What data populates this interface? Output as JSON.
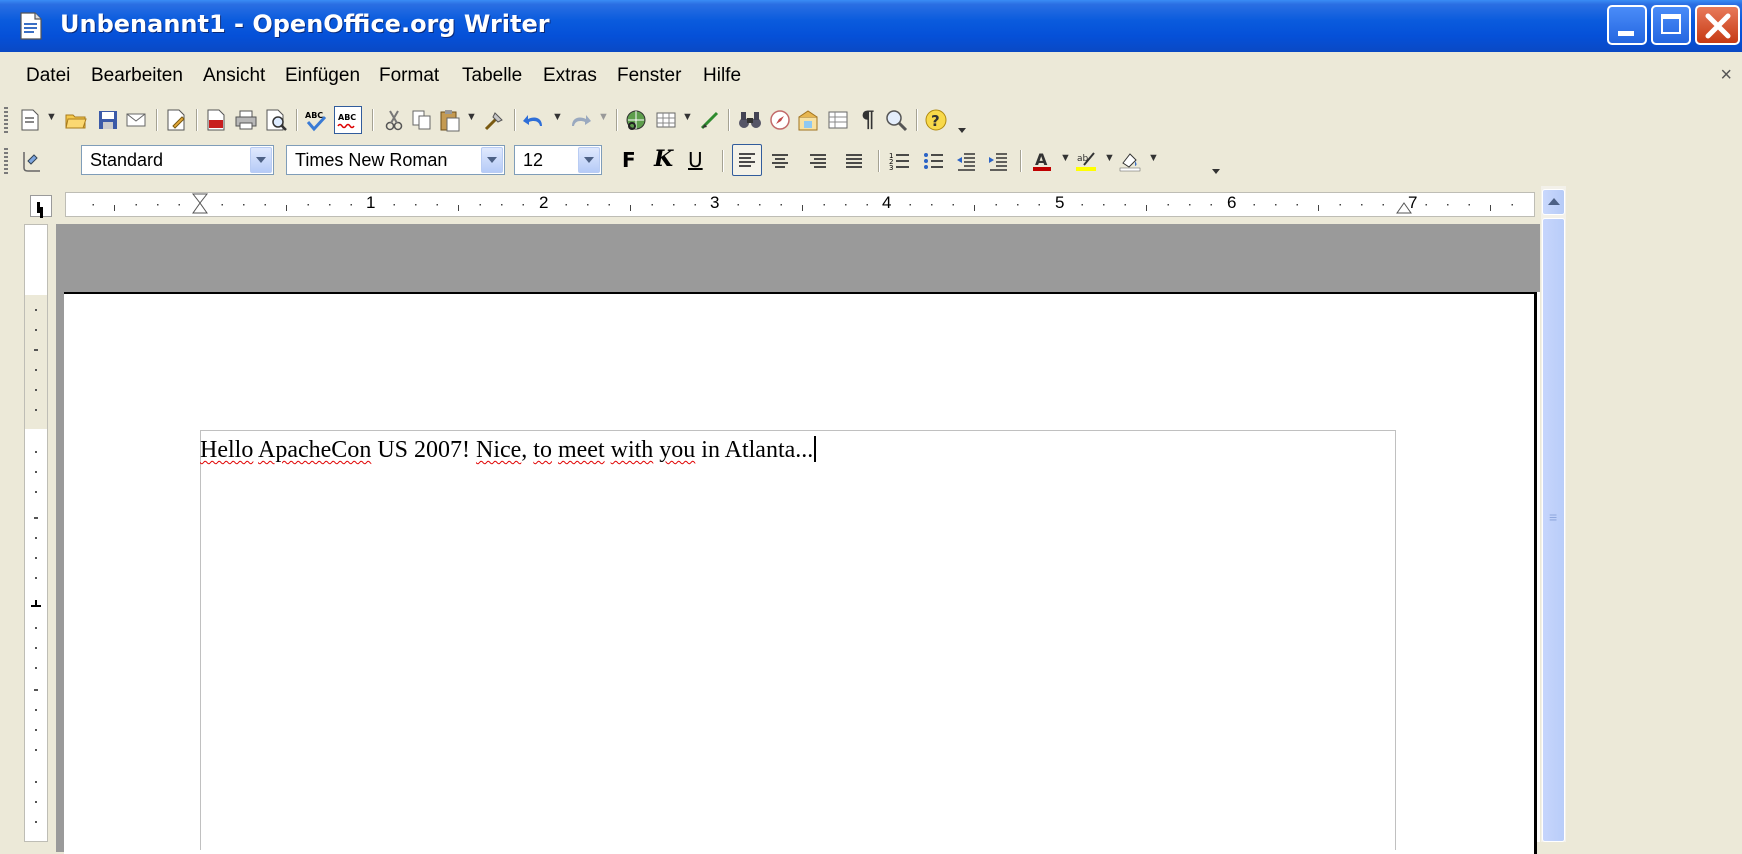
{
  "window": {
    "title": "Unbenannt1 - OpenOffice.org Writer",
    "title_bar_color": "#0A5BDD"
  },
  "menubar": {
    "items": [
      "Datei",
      "Bearbeiten",
      "Ansicht",
      "Einfügen",
      "Format",
      "Tabelle",
      "Extras",
      "Fenster",
      "Hilfe"
    ],
    "close_glyph": "×"
  },
  "standard_toolbar": {
    "icons": [
      "new-document-icon",
      "open-folder-icon",
      "save-icon",
      "email-icon",
      "edit-file-icon",
      "export-pdf-icon",
      "print-icon",
      "page-preview-icon",
      "spellcheck-icon",
      "autospellcheck-icon",
      "cut-icon",
      "copy-icon",
      "paste-icon",
      "clone-formatting-icon",
      "undo-icon",
      "redo-icon",
      "hyperlink-icon",
      "table-icon",
      "show-draw-functions-icon",
      "find-replace-icon",
      "navigator-icon",
      "gallery-icon",
      "data-sources-icon",
      "formatting-marks-icon",
      "zoom-icon",
      "help-icon"
    ]
  },
  "formatting_toolbar": {
    "style": "Standard",
    "font_name": "Times New Roman",
    "font_size": "12",
    "bold_label": "F",
    "italic_label": "K",
    "underline_label": "U",
    "font_color": "#C00000",
    "highlight_color": "#FFFF00"
  },
  "ruler": {
    "labels": [
      "1",
      "2",
      "3",
      "4",
      "5",
      "6",
      "7"
    ]
  },
  "document": {
    "words": [
      {
        "text": "Hello",
        "misspelled": true
      },
      {
        "text": " ",
        "misspelled": false
      },
      {
        "text": "ApacheCon",
        "misspelled": true
      },
      {
        "text": " US 2007! ",
        "misspelled": false
      },
      {
        "text": "Nice",
        "misspelled": true
      },
      {
        "text": ", ",
        "misspelled": false
      },
      {
        "text": "to",
        "misspelled": true
      },
      {
        "text": " ",
        "misspelled": false
      },
      {
        "text": "meet",
        "misspelled": true
      },
      {
        "text": " ",
        "misspelled": false
      },
      {
        "text": "with",
        "misspelled": true
      },
      {
        "text": " ",
        "misspelled": false
      },
      {
        "text": "you",
        "misspelled": true
      },
      {
        "text": " in Atlanta...",
        "misspelled": false
      }
    ]
  }
}
